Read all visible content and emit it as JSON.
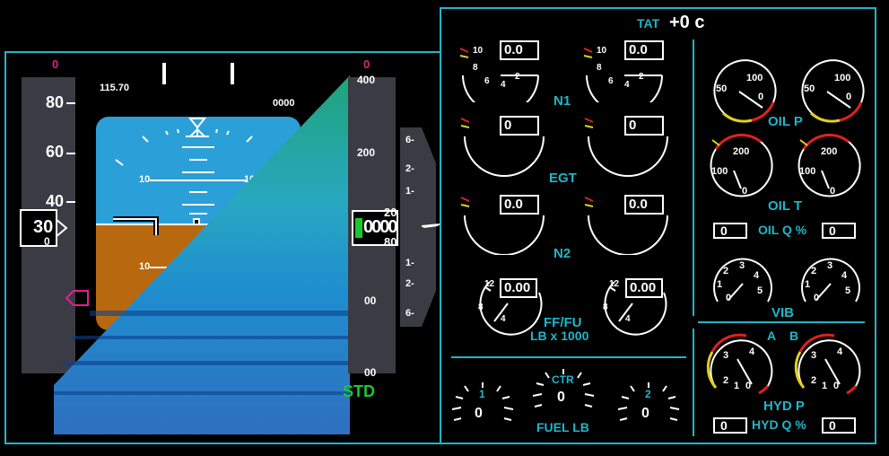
{
  "pfd": {
    "speed_top_marker": "0",
    "speed_ticks": [
      "80",
      "60",
      "40"
    ],
    "speed_current": "30",
    "speed_current_sub": "0",
    "nav_freq": "115.70",
    "altitude_setting_top": "0000",
    "alt_top_marker": "0",
    "alt_ticks": [
      "400",
      "200",
      "00",
      "00"
    ],
    "alt_current": "0000",
    "alt_current_top": "20",
    "alt_current_bottom": "80",
    "pitch_labels": [
      "10",
      "10",
      "10"
    ],
    "baro": "STD",
    "vs_labels": [
      "6-",
      "2-",
      "1-",
      "1-",
      "2-",
      "6-"
    ],
    "colors": {
      "sky": "#2b9fd8",
      "ground": "#b8690f",
      "magenta": "#e0208c",
      "green": "#19c92c"
    }
  },
  "eicas": {
    "tat_label": "TAT",
    "tat_value": "+0 c",
    "n1": {
      "label": "N1",
      "left": "0.0",
      "right": "0.0",
      "scale": [
        "10",
        "8",
        "6",
        "4",
        "2"
      ]
    },
    "egt": {
      "label": "EGT",
      "left": "0",
      "right": "0"
    },
    "n2": {
      "label": "N2",
      "left": "0.0",
      "right": "0.0"
    },
    "ff": {
      "label": "FF/FU",
      "sub": "LB x 1000",
      "left": "0.00",
      "right": "0.00",
      "scale": [
        "12",
        "8",
        "4"
      ]
    },
    "fuel": {
      "label": "FUEL LB",
      "tank1": "1",
      "ctr": "CTR",
      "tank2": "2",
      "v1": "0",
      "vctr": "0",
      "v2": "0"
    },
    "oil_p": {
      "label": "OIL P",
      "scale": [
        "50",
        "100",
        "0"
      ]
    },
    "oil_t": {
      "label": "OIL T",
      "scale": [
        "200",
        "100",
        "0"
      ]
    },
    "oil_q": {
      "label": "OIL Q %",
      "left": "0",
      "right": "0"
    },
    "vib": {
      "label": "VIB",
      "scale": [
        "2",
        "3",
        "4",
        "1",
        "5",
        "0"
      ]
    },
    "hyd": {
      "label_a": "A",
      "label_b": "B",
      "label": "HYD P",
      "scale": [
        "3",
        "4",
        "2",
        "1",
        "0"
      ]
    },
    "hyd_q": {
      "label": "HYD Q %",
      "left": "0",
      "right": "0"
    }
  }
}
